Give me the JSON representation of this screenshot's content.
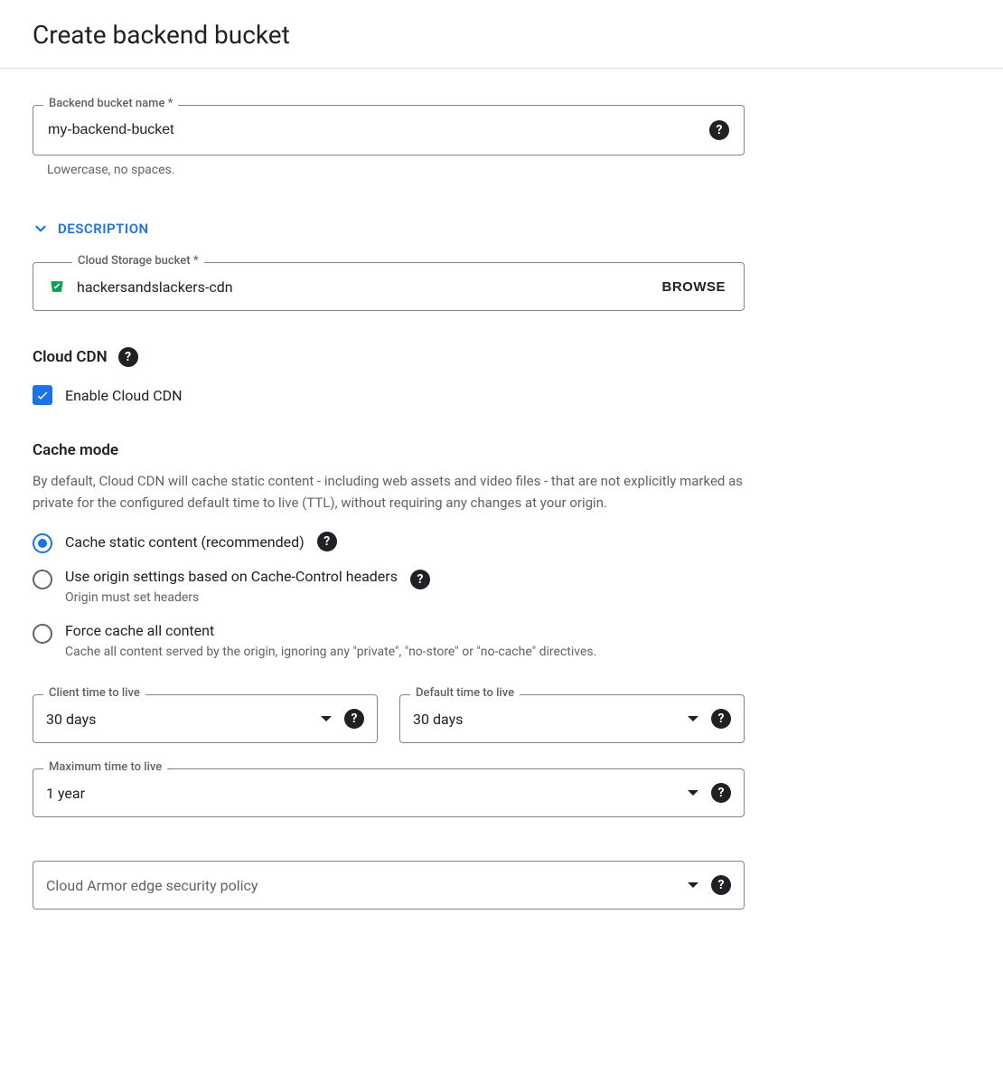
{
  "page_title": "Create backend bucket",
  "backend_name": {
    "label": "Backend bucket name *",
    "value": "my-backend-bucket",
    "helper": "Lowercase, no spaces."
  },
  "description_toggle": "DESCRIPTION",
  "storage_bucket": {
    "label": "Cloud Storage bucket *",
    "value": "hackersandslackers-cdn",
    "browse": "BROWSE"
  },
  "cdn": {
    "heading": "Cloud CDN",
    "checkbox_label": "Enable Cloud CDN"
  },
  "cache": {
    "heading": "Cache mode",
    "desc": "By default, Cloud CDN will cache static content - including web assets and video files - that are not explicitly marked as private for the configured default time to live (TTL), without requiring any changes at your origin.",
    "options": [
      {
        "label": "Cache static content (recommended)",
        "sub": "",
        "help": true
      },
      {
        "label": "Use origin settings based on Cache-Control headers",
        "sub": "Origin must set headers",
        "help": true
      },
      {
        "label": "Force cache all content",
        "sub": "Cache all content served by the origin, ignoring any \"private\", \"no-store\" or \"no-cache\" directives.",
        "help": false
      }
    ]
  },
  "ttl": {
    "client": {
      "label": "Client time to live",
      "value": "30 days"
    },
    "default": {
      "label": "Default time to live",
      "value": "30 days"
    },
    "max": {
      "label": "Maximum time to live",
      "value": "1 year"
    }
  },
  "armor": {
    "placeholder": "Cloud Armor edge security policy"
  }
}
